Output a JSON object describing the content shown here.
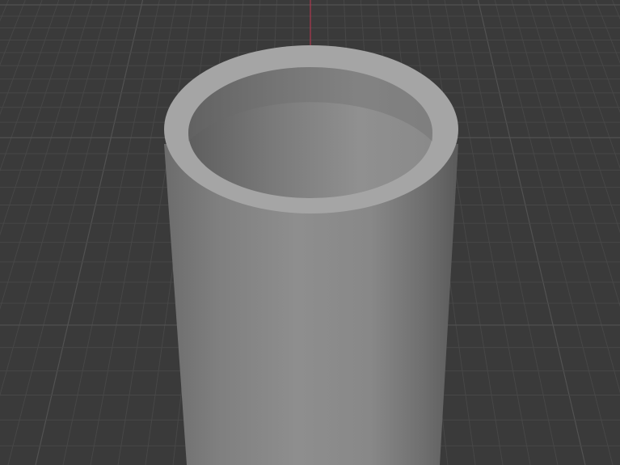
{
  "viewport": {
    "background_color": "#3a3a3a",
    "grid_minor_color": "#474747",
    "grid_major_color": "#525252",
    "axis_z_color": "#c2334f"
  },
  "scene": {
    "object": "hollow-cylinder-tube",
    "body_color_dark": "#5b5b5b",
    "body_color_mid": "#8a8a8a",
    "body_color_light": "#9c9c9c",
    "rim_color": "#a3a3a3",
    "inner_color_dark": "#5f5f5f",
    "inner_color_light": "#8e8e8e"
  }
}
